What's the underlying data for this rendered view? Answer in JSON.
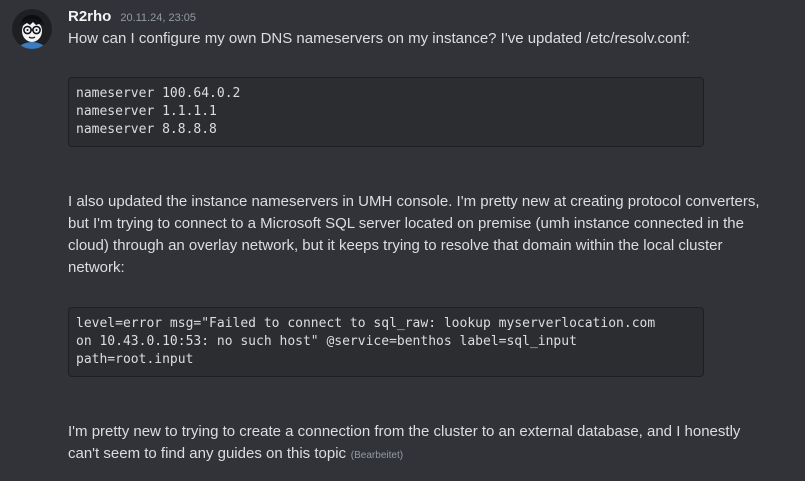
{
  "message": {
    "author": "R2rho",
    "timestamp": "20.11.24, 23:05",
    "avatar_icon": "cartoon-face-with-glasses",
    "paragraph_1": "How can I configure my own DNS nameservers on my instance? I've updated /etc/resolv.conf:",
    "code_block_1": [
      "nameserver 100.64.0.2",
      "nameserver 1.1.1.1",
      "nameserver 8.8.8.8"
    ],
    "paragraph_2": [
      "I also updated the instance nameservers in UMH console. I'm pretty new at creating protocol converters,",
      "but I'm trying to connect to a Microsoft SQL server located on premise (umh instance connected in the",
      "cloud) through an overlay network, but it keeps trying to resolve that domain within the local cluster",
      "network:"
    ],
    "code_block_2": [
      "level=error msg=\"Failed to connect to sql_raw: lookup myserverlocation.com",
      "on 10.43.0.10:53: no such host\" @service=benthos label=sql_input",
      "path=root.input"
    ],
    "paragraph_3": [
      "I'm pretty new to trying to create a connection from the cluster to an external database, and I honestly",
      "can't seem to find any guides on this topic"
    ],
    "edited_label": "(Bearbeitet)"
  },
  "colors": {
    "background": "#313338",
    "code_background": "#2b2d31",
    "text": "#dbdee1",
    "muted": "#949ba4"
  }
}
